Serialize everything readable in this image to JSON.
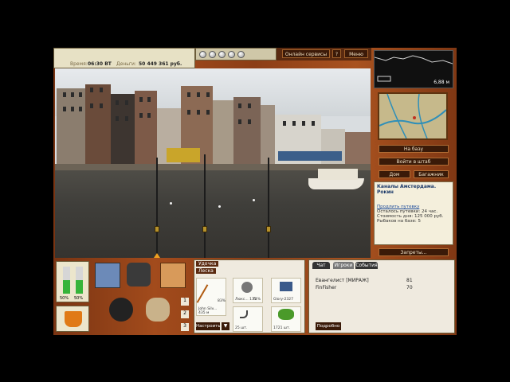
{
  "hud": {
    "time_label": "Время:",
    "time_value": "06:30 ВТ",
    "money_label": "Деньги:",
    "money_value": "50 449 361 руб.",
    "online_services": "Онлайн сервисы",
    "help": "?",
    "menu": "Меню",
    "bait_count": 5
  },
  "sonar": {
    "depth": "6,88 м"
  },
  "right_panel": {
    "to_base": "На базу",
    "to_hq": "Войти в штаб",
    "home": "Дом",
    "luggage": "Багажник",
    "location_title": "Каналы Амстердама. Рокин",
    "extend_trip": "Продлить путевку",
    "days_left": "Осталось путевки: 24 час.",
    "day_cost": "Стоимость дня: 125 000 руб.",
    "anglers": "Рыбаков на базе: 5",
    "bans": "Запреты..."
  },
  "gauges": {
    "left_value": "50%",
    "right_value": "50%",
    "left_level": 0.5,
    "right_level": 0.5
  },
  "inventory": {
    "page_numbers": [
      "1",
      "2",
      "3"
    ]
  },
  "tackle": {
    "tabs": [
      "Удочка",
      "Леска"
    ],
    "rod_name": "John Silv...",
    "rod_length": "435 м",
    "rod_percent": "83%",
    "reel_stat": "Люкс... 135",
    "reel_percent": "74%",
    "lure_label": "Glory-2327",
    "hook_count": "25 шт.",
    "bait_count": "1721 шт.",
    "setup_button": "Настроить"
  },
  "chat": {
    "tabs": [
      "Чат",
      "Игроки",
      "События"
    ],
    "players": [
      {
        "name": "Евангелист [МИРАЖ]",
        "score": "81"
      },
      {
        "name": "FinFisher",
        "score": "70"
      }
    ],
    "more_button": "Подробно"
  }
}
